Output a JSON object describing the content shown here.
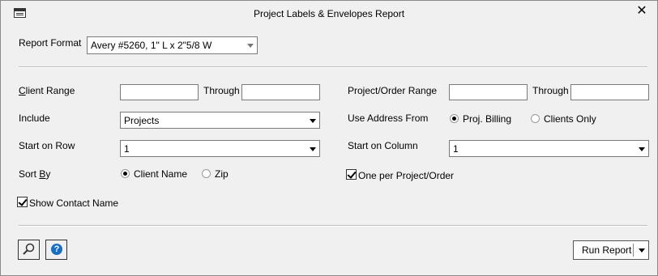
{
  "window": {
    "title": "Project Labels & Envelopes Report",
    "close_glyph": "✕"
  },
  "report_format": {
    "label": "Report Format",
    "value": "Avery #5260, 1\" L x 2\"5/8 W"
  },
  "client_range": {
    "label_u": "C",
    "label_rest": "lient Range",
    "through_label": "Through",
    "from_value": "",
    "to_value": ""
  },
  "project_range": {
    "label": "Project/Order Range",
    "through_label": "Through",
    "from_value": "",
    "to_value": ""
  },
  "include": {
    "label": "Include",
    "value": "Projects"
  },
  "use_address_from": {
    "label": "Use Address From",
    "options": [
      "Proj. Billing",
      "Clients Only"
    ],
    "selected": "Proj. Billing"
  },
  "start_on_row": {
    "label": "Start on Row",
    "value": "1"
  },
  "start_on_column": {
    "label": "Start on Column",
    "value": "1"
  },
  "sort_by": {
    "label_main": "Sort ",
    "label_u": "B",
    "label_rest": "y",
    "options": [
      "Client Name",
      "Zip"
    ],
    "selected": "Client Name"
  },
  "one_per_project": {
    "label": "One per Project/Order",
    "checked": true
  },
  "show_contact_name": {
    "label": "Show Contact Name",
    "checked": true
  },
  "footer": {
    "run_report_label": "Run Report",
    "help_glyph": "?"
  }
}
